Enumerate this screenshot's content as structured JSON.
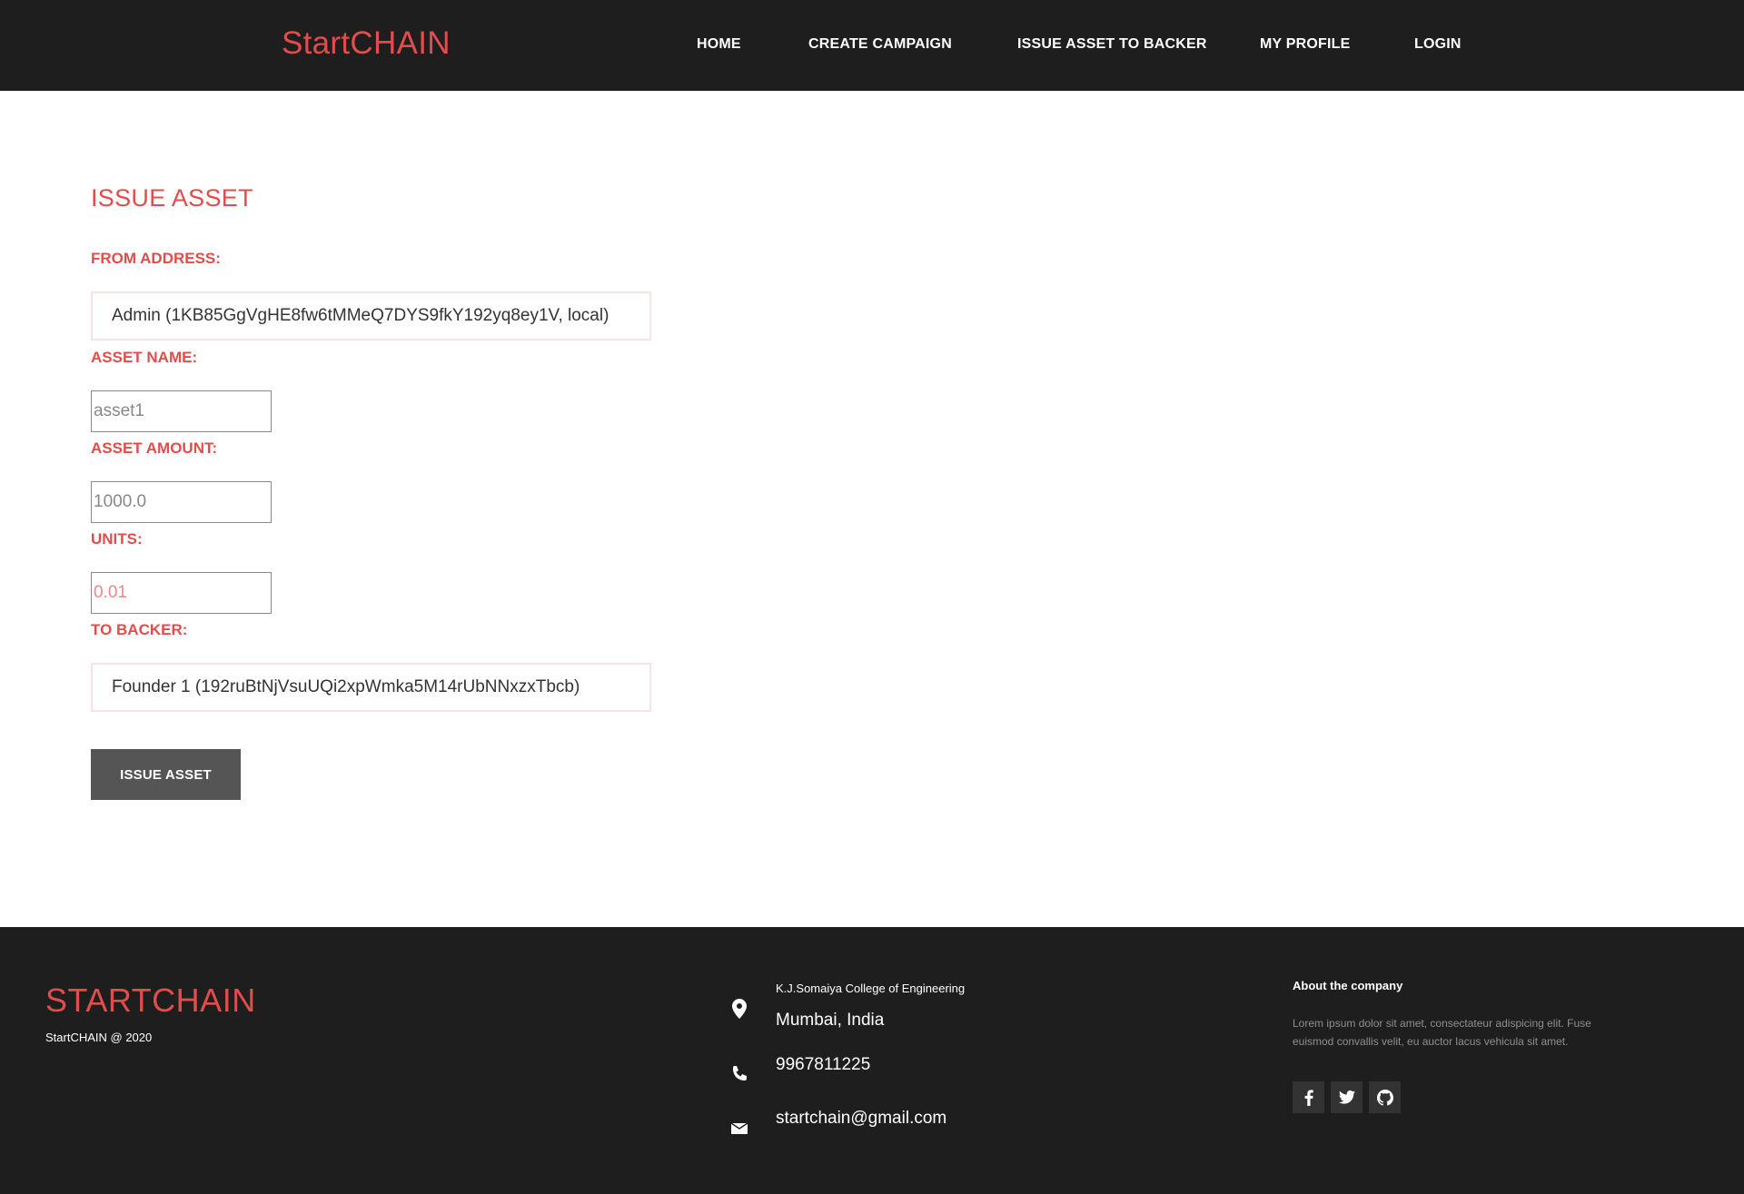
{
  "nav": {
    "brand": "StartCHAIN",
    "links": [
      "HOME",
      "CREATE CAMPAIGN",
      "ISSUE ASSET TO BACKER",
      "MY PROFILE",
      "LOGIN"
    ]
  },
  "form": {
    "title": "ISSUE ASSET",
    "from_label": "FROM ADDRESS:",
    "from_value": "Admin (1KB85GgVgHE8fw6tMMeQ7DYS9fkY192yq8ey1V, local)",
    "asset_name_label": "ASSET NAME:",
    "asset_name_placeholder": "asset1",
    "asset_amount_label": "ASSET AMOUNT:",
    "asset_amount_placeholder": "1000.0",
    "units_label": "UNITS:",
    "units_placeholder": "0.01",
    "backer_label": "TO BACKER:",
    "backer_value": "Founder 1 (192ruBtNjVsuUQi2xpWmka5M14rUbNNxzxTbcb)",
    "submit_label": "ISSUE ASSET"
  },
  "footer": {
    "brand": "STARTCHAIN",
    "copyright": "StartCHAIN @ 2020",
    "address_line1": "K.J.Somaiya College of Engineering",
    "address_line2": "Mumbai, India",
    "phone": "9967811225",
    "email": "startchain@gmail.com",
    "about_title": "About the company",
    "about_text": "Lorem ipsum dolor sit amet, consectateur adispicing elit. Fuse euismod convallis velit, eu auctor lacus vehicula sit amet.",
    "social": [
      "facebook-icon",
      "twitter-icon",
      "github-icon"
    ]
  },
  "colors": {
    "accent": "#e24c4b",
    "dark": "#1e1e1e",
    "button": "#555555"
  }
}
